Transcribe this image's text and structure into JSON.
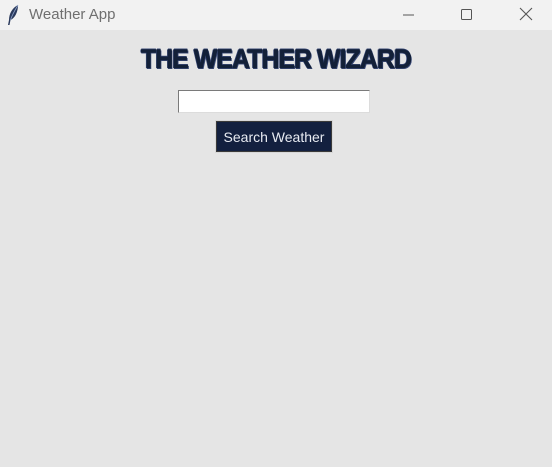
{
  "window": {
    "title": "Weather App",
    "app_icon": "feather-icon",
    "controls": {
      "minimize_icon": "minimize-icon",
      "maximize_icon": "maximize-icon",
      "close_icon": "close-icon"
    }
  },
  "main": {
    "heading": "THE WEATHER WIZARD",
    "search_value": "",
    "search_button_label": "Search Weather"
  },
  "colors": {
    "background": "#e5e5e5",
    "heading": "#132038",
    "button_bg": "#13203f",
    "button_text": "#e8ebf2"
  }
}
